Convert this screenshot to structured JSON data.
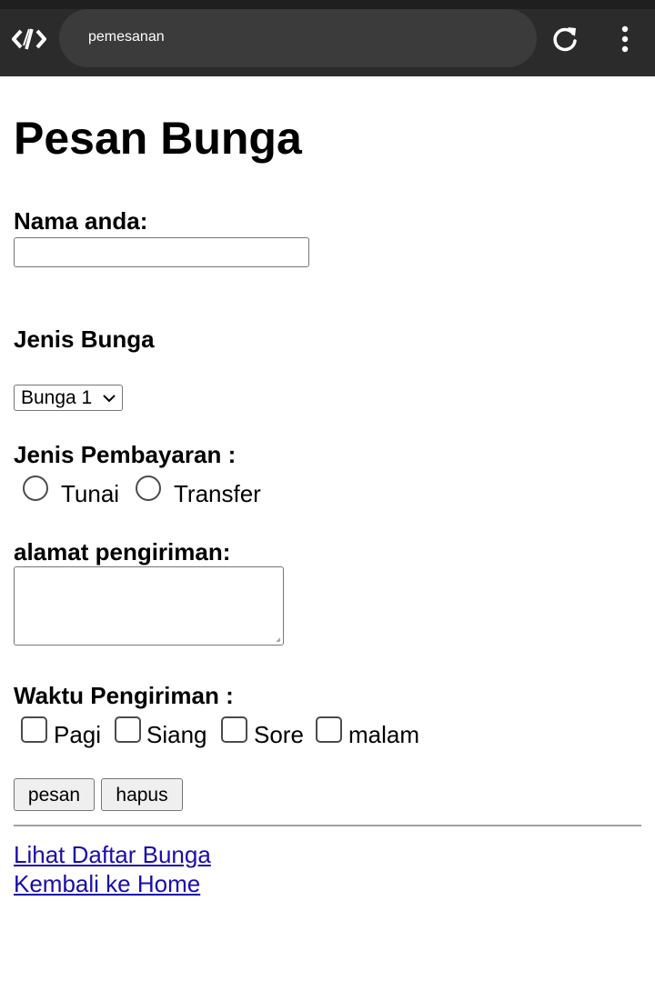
{
  "browser": {
    "url_text": "pemesanan",
    "logo_icon": "code-brackets-icon",
    "reload_icon": "reload-icon",
    "menu_icon": "kebab-menu-icon"
  },
  "page": {
    "title": "Pesan Bunga",
    "name_label": "Nama anda:",
    "name_value": "",
    "flower_label": "Jenis Bunga",
    "flower_selected": "Bunga 1",
    "payment_label": "Jenis Pembayaran :",
    "payment_options": [
      "Tunai",
      "Transfer"
    ],
    "address_label": "alamat pengiriman:",
    "address_value": "",
    "time_label": "Waktu Pengiriman :",
    "time_options": [
      "Pagi",
      "Siang",
      "Sore",
      "malam"
    ],
    "submit_label": "pesan",
    "reset_label": "hapus",
    "links": [
      "Lihat Daftar Bunga",
      "Kembali ke Home"
    ]
  }
}
